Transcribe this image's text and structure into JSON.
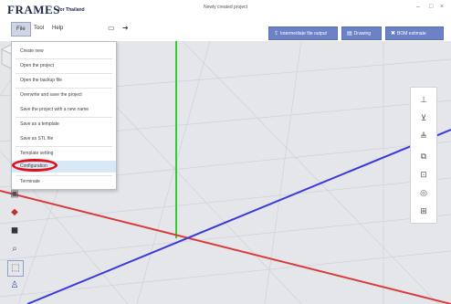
{
  "app": {
    "logo": "FRAMES",
    "logo_sub": "for Thailand",
    "window_title": "Newly created project",
    "win_minimize": "–",
    "win_maximize": "□",
    "win_close": "×"
  },
  "menu": {
    "file": "File",
    "tool": "Tool",
    "help": "Help"
  },
  "toolbar_buttons": {
    "intermediate": "Intermediate file output",
    "drawing": "Drawing",
    "bom": "BOM estimate"
  },
  "file_menu": {
    "items": [
      "Create new",
      "Open the project",
      "Open the backup file",
      "Overwrite and save the project",
      "Save the project with a new name",
      "Save as a template",
      "Save as STL file",
      "Template setting",
      "Configuration",
      "Terminate"
    ],
    "highlighted": "Configuration"
  },
  "axes": {
    "x_color": "#d83a3a",
    "y_color": "#3a3ad8",
    "z_color": "#2bd02b"
  },
  "colors": {
    "accent_button": "#6b82c6",
    "highlight_circle": "#e0101a"
  },
  "icons": {
    "right_toolbar": [
      "align-top-icon",
      "align-bottom-icon",
      "align-middle-icon",
      "fit-icon",
      "zoom-fit-icon",
      "camera-icon",
      "measure-icon"
    ],
    "left_toolbar": [
      "cube-solid-icon",
      "cube-red-icon",
      "cube-dark-icon",
      "search-icon",
      "frame-icon",
      "person-icon"
    ]
  }
}
